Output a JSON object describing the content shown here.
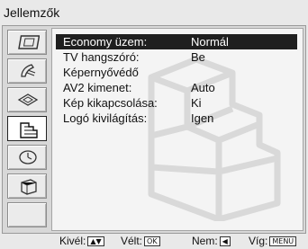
{
  "title": "Jellemzők",
  "sidebar": {
    "items": [
      {
        "icon": "picture-icon"
      },
      {
        "icon": "sound-icon"
      },
      {
        "icon": "screen-icon"
      },
      {
        "icon": "features-icon",
        "selected": true
      },
      {
        "icon": "setup-icon"
      },
      {
        "icon": "pc-settings-icon"
      },
      {
        "icon": "empty"
      }
    ]
  },
  "menu": {
    "items": [
      {
        "label": "Economy üzem:",
        "value": "Normál",
        "selected": true
      },
      {
        "label": "TV hangszóró:",
        "value": "Be"
      },
      {
        "label": "Képernyővédő",
        "value": ""
      },
      {
        "label": "AV2 kimenet:",
        "value": "Auto"
      },
      {
        "label": "Kép kikapcsolása:",
        "value": "Ki"
      },
      {
        "label": "Logó kivilágítás:",
        "value": "Igen"
      }
    ]
  },
  "footer": {
    "select_label": "Kivél:",
    "select_keys": "▲▼",
    "confirm_label": "Vélt:",
    "confirm_key": "OK",
    "back_label": "Nem:",
    "back_key": "◀",
    "exit_label": "Víg:",
    "exit_key": "MENU"
  }
}
